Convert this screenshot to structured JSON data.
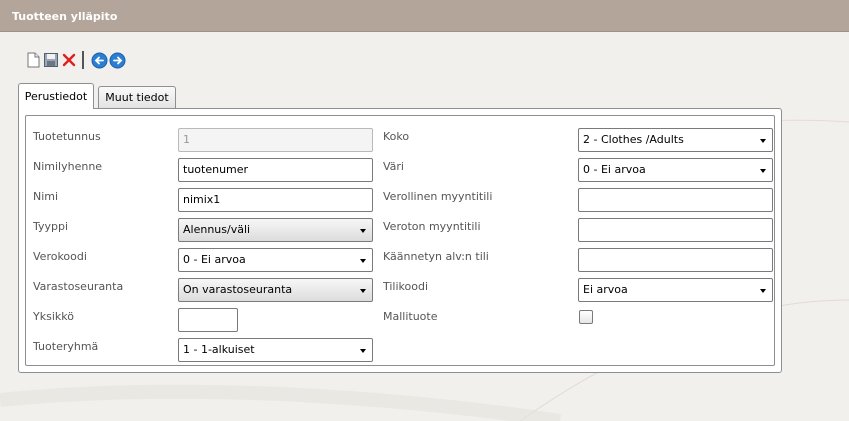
{
  "header": {
    "title": "Tuotteen ylläpito"
  },
  "toolbar": {
    "icons": [
      "new-document-icon",
      "save-icon",
      "delete-icon",
      "back-icon",
      "forward-icon"
    ],
    "colors": {
      "delete": "#e02020",
      "nav": "#2a7fd4"
    }
  },
  "tabs": [
    {
      "label": "Perustiedot",
      "active": true
    },
    {
      "label": "Muut tiedot",
      "active": false
    }
  ],
  "form": {
    "left": {
      "product_id": {
        "label": "Tuotetunnus",
        "value": "1"
      },
      "short_name": {
        "label": "Nimilyhenne",
        "value": "tuotenumer"
      },
      "name": {
        "label": "Nimi",
        "value": "nimix1"
      },
      "type": {
        "label": "Tyyppi",
        "value": "Alennus/väli"
      },
      "tax_code": {
        "label": "Verokoodi",
        "value": "0 - Ei arvoa"
      },
      "stock_tracking": {
        "label": "Varastoseuranta",
        "value": "On varastoseuranta"
      },
      "unit": {
        "label": "Yksikkö",
        "value": ""
      },
      "product_group": {
        "label": "Tuoteryhmä",
        "value": "1 - 1-alkuiset"
      }
    },
    "right": {
      "size": {
        "label": "Koko",
        "value": "2 - Clothes /Adults"
      },
      "color": {
        "label": "Väri",
        "value": "0 - Ei arvoa"
      },
      "taxable_sales_account": {
        "label": "Verollinen myyntitili",
        "value": ""
      },
      "taxfree_sales_account": {
        "label": "Veroton myyntitili",
        "value": ""
      },
      "reverse_vat_account": {
        "label": "Käännetyn alv:n tili",
        "value": ""
      },
      "account_code": {
        "label": "Tilikoodi",
        "value": "Ei arvoa"
      },
      "model_product": {
        "label": "Mallituote",
        "checked": false
      }
    }
  }
}
